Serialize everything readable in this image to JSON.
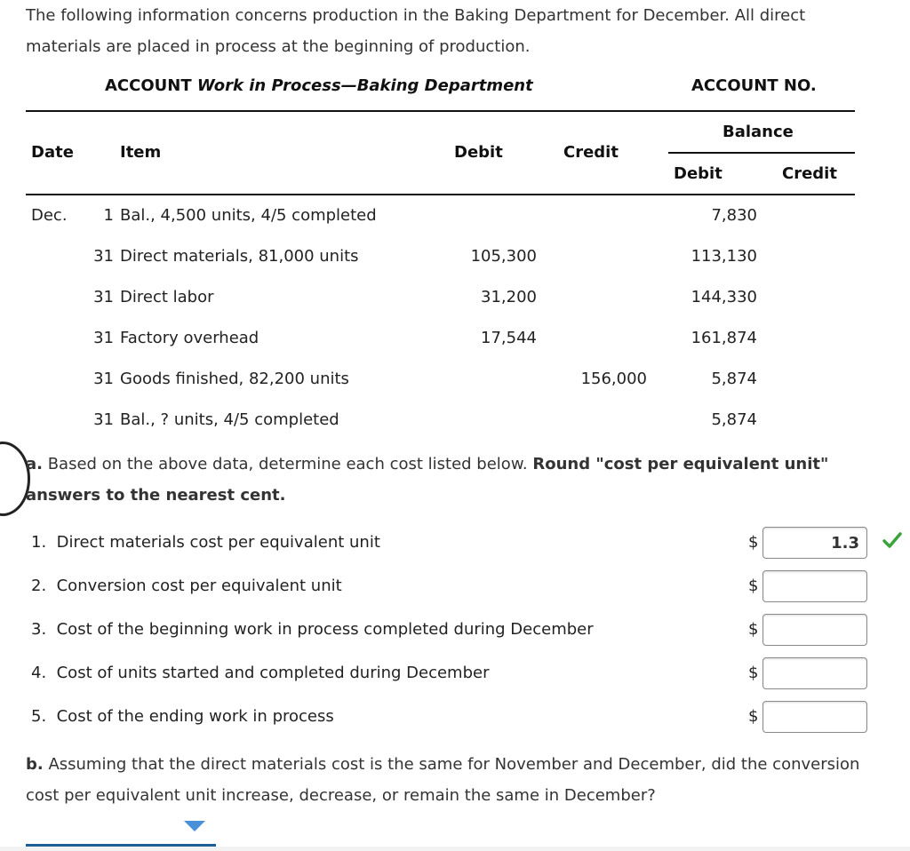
{
  "intro": "The following information concerns production in the Baking Department for December. All direct materials are placed in process at the beginning of production.",
  "account": {
    "label": "ACCOUNT",
    "name": "Work in Process—Baking Department",
    "number_label": "ACCOUNT NO."
  },
  "ledger": {
    "headers": {
      "date": "Date",
      "item": "Item",
      "debit": "Debit",
      "credit": "Credit",
      "balance": "Balance",
      "balance_debit": "Debit",
      "balance_credit": "Credit"
    },
    "month": "Dec.",
    "rows": [
      {
        "day": "1",
        "item": "Bal., 4,500 units, 4/5 completed",
        "debit": "",
        "credit": "",
        "bal_debit": "7,830",
        "bal_credit": ""
      },
      {
        "day": "31",
        "item": "Direct materials, 81,000 units",
        "debit": "105,300",
        "credit": "",
        "bal_debit": "113,130",
        "bal_credit": ""
      },
      {
        "day": "31",
        "item": "Direct labor",
        "debit": "31,200",
        "credit": "",
        "bal_debit": "144,330",
        "bal_credit": ""
      },
      {
        "day": "31",
        "item": "Factory overhead",
        "debit": "17,544",
        "credit": "",
        "bal_debit": "161,874",
        "bal_credit": ""
      },
      {
        "day": "31",
        "item": "Goods finished, 82,200 units",
        "debit": "",
        "credit": "156,000",
        "bal_debit": "5,874",
        "bal_credit": ""
      },
      {
        "day": "31",
        "item": "Bal., ? units, 4/5 completed",
        "debit": "",
        "credit": "",
        "bal_debit": "5,874",
        "bal_credit": ""
      }
    ]
  },
  "part_a": {
    "letter": "a.",
    "text": " Based on the above data, determine each cost listed below. ",
    "bold_text": "Round \"cost per equivalent unit\" answers to the nearest cent.",
    "currency": "$",
    "questions": [
      {
        "label": "1.  Direct materials cost per equivalent unit",
        "value": "1.3",
        "correct": true
      },
      {
        "label": "2.  Conversion cost per equivalent unit",
        "value": ""
      },
      {
        "label": "3.  Cost of the beginning work in process completed during December",
        "value": ""
      },
      {
        "label": "4.  Cost of units started and completed during December",
        "value": ""
      },
      {
        "label": "5.  Cost of the ending work in process",
        "value": ""
      }
    ]
  },
  "part_b": {
    "letter": "b.",
    "text": " Assuming that the direct materials cost is the same for November and December, did the conversion cost per equivalent unit increase, decrease, or remain the same in December?",
    "dropdown_value": ""
  },
  "colors": {
    "check": "#3aa33a",
    "dropdown_underline": "#1d5e96",
    "dropdown_arrow": "#4a90d9"
  }
}
